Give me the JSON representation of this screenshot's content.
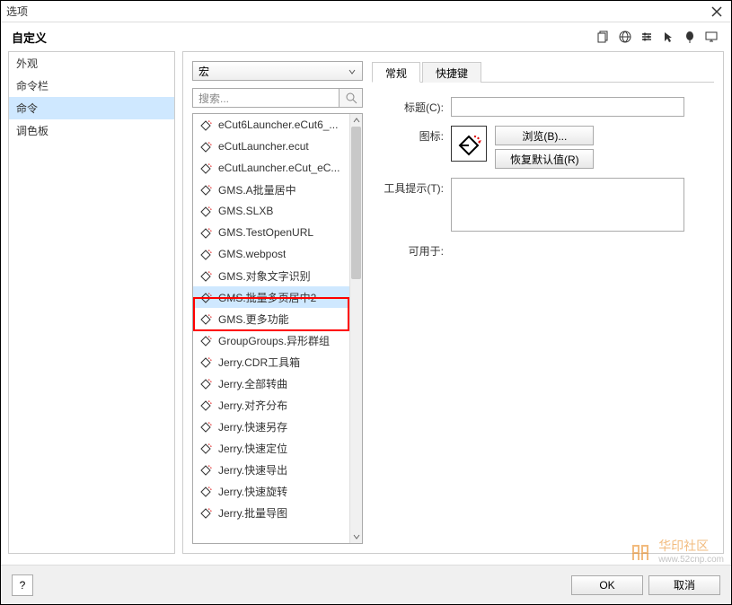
{
  "window": {
    "title": "选项"
  },
  "header": {
    "heading": "自定义",
    "tools": [
      "copy-icon",
      "globe-icon",
      "settings-icon",
      "cursor-icon",
      "balloon-icon",
      "monitor-icon"
    ]
  },
  "sidebar": {
    "items": [
      {
        "label": "外观",
        "selected": false
      },
      {
        "label": "命令栏",
        "selected": false
      },
      {
        "label": "命令",
        "selected": true
      },
      {
        "label": "调色板",
        "selected": false
      }
    ]
  },
  "combo": {
    "value": "宏"
  },
  "search": {
    "placeholder": "搜索..."
  },
  "list": {
    "selectedIndex": 8,
    "items": [
      "eCut6Launcher.eCut6_...",
      "eCutLauncher.ecut",
      "eCutLauncher.eCut_eC...",
      "GMS.A批量居中",
      "GMS.SLXB",
      "GMS.TestOpenURL",
      "GMS.webpost",
      "GMS.对象文字识别",
      "GMS.批量多页居中2",
      "GMS.更多功能",
      "GroupGroups.异形群组",
      "Jerry.CDR工具箱",
      "Jerry.全部转曲",
      "Jerry.对齐分布",
      "Jerry.快速另存",
      "Jerry.快速定位",
      "Jerry.快速导出",
      "Jerry.快速旋转",
      "Jerry.批量导图"
    ]
  },
  "tabs": [
    {
      "label": "常规",
      "active": true
    },
    {
      "label": "快捷键",
      "active": false
    }
  ],
  "form": {
    "title_label": "标题(C):",
    "title_value": "",
    "icon_label": "图标:",
    "browse_btn": "浏览(B)...",
    "restore_btn": "恢复默认值(R)",
    "tooltip_label": "工具提示(T):",
    "tooltip_value": "",
    "available_label": "可用于:"
  },
  "footer": {
    "help": "?",
    "ok": "OK",
    "cancel": "取消"
  },
  "watermark": {
    "text": "华印社区",
    "url": "www.52cnp.com"
  }
}
